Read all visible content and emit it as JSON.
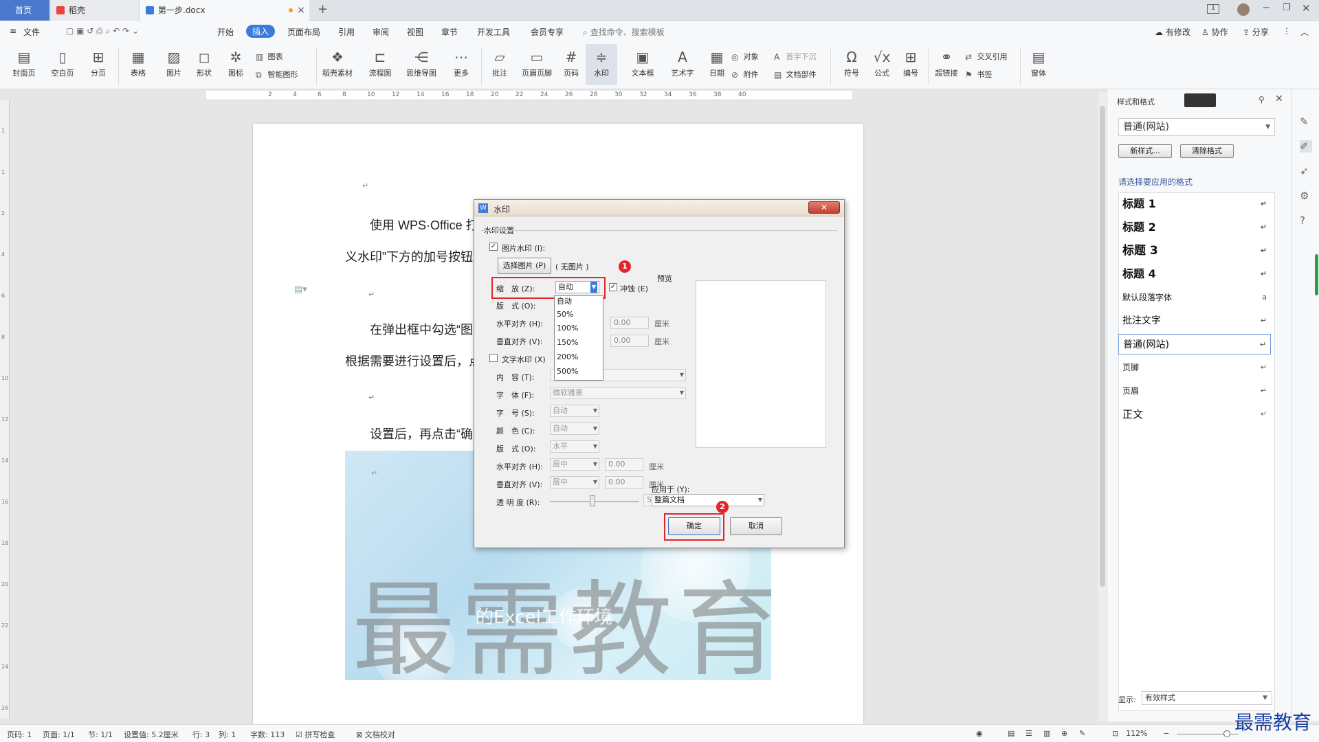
{
  "tabs": {
    "home": "首页",
    "daoke": "稻壳",
    "doc": "第一步.docx"
  },
  "menu": {
    "file": "文件",
    "start": "开始",
    "insert": "插入",
    "layout": "页面布局",
    "ref": "引用",
    "review": "审阅",
    "view": "视图",
    "chapter": "章节",
    "dev": "开发工具",
    "member": "会员专享",
    "search": "查找命令、搜索模板",
    "modified": "有修改",
    "collab": "协作",
    "share": "分享"
  },
  "ribbon": {
    "cover": "封面页",
    "blank": "空白页",
    "pagebreak": "分页",
    "table": "表格",
    "picture": "图片",
    "shape": "形状",
    "icon": "图标",
    "chart": "图表",
    "smart": "智能图形",
    "material": "稻壳素材",
    "flow": "流程图",
    "mind": "思维导图",
    "more": "更多",
    "comment": "批注",
    "headerfooter": "页眉页脚",
    "pagenum": "页码",
    "watermark": "水印",
    "textbox": "文本框",
    "wordart": "艺术字",
    "date": "日期",
    "object": "对象",
    "attach": "附件",
    "dropcap": "首字下沉",
    "docpart": "文档部件",
    "symbol": "符号",
    "formula": "公式",
    "number": "编号",
    "hyperlink": "超链接",
    "crossref": "交叉引用",
    "bookmark": "书签",
    "window": "窗体"
  },
  "doc": {
    "p1": "使用 WPS·Office 打",
    "p2": "义水印”下方的加号按钮",
    "p3": "在弹出框中勾选“图",
    "p4": "根据需要进行设置后，点",
    "p5": "设置后，再点击“确",
    "wm_main": "最需教育",
    "wm_sub": "的Excel工作环境"
  },
  "dialog": {
    "title": "水印",
    "close": "✕",
    "section": "水印设置",
    "pic_wm": "图片水印 (I):",
    "select_pic": "选择图片 (P)",
    "no_pic": "( 无图片 )",
    "scale": "缩　放 (Z):",
    "scale_val": "自动",
    "washout": "冲蚀 (E)",
    "layout": "版　式 (O):",
    "halign": "水平对齐 (H):",
    "valign": "垂直对齐 (V):",
    "h_val": "0.00",
    "v_val": "0.00",
    "cm": "厘米",
    "text_wm": "文字水印 (X)",
    "content": "内　容 (T):",
    "font": "字　体 (F):",
    "font_val": "微软雅黑",
    "size": "字　号 (S):",
    "size_val": "自动",
    "color": "颜　色 (C):",
    "color_val": "自动",
    "tlayout": "版　式 (O):",
    "tlayout_val": "水平",
    "thalign": "水平对齐 (H):",
    "thalign_val": "居中",
    "tvalign": "垂直对齐 (V):",
    "tvalign_val": "居中",
    "t_h": "0.00",
    "t_v": "0.00",
    "opacity": "透 明 度 (R):",
    "opacity_val": "50",
    "pct": "%",
    "preview": "预览",
    "apply": "应用于 (Y):",
    "apply_val": "整篇文档",
    "ok": "确定",
    "cancel": "取消",
    "options": [
      "自动",
      "50%",
      "100%",
      "150%",
      "200%",
      "500%"
    ],
    "badge1": "1",
    "badge2": "2"
  },
  "rightpane": {
    "title": "样式和格式",
    "current": "普通(网站)",
    "new": "新样式...",
    "clear": "清除格式",
    "prompt": "请选择要应用的格式",
    "styles": [
      "标题 1",
      "标题 2",
      "标题 3",
      "标题 4",
      "默认段落字体",
      "批注文字",
      "普通(网站)",
      "页脚",
      "页眉",
      "正文"
    ],
    "show": "显示:",
    "show_val": "有效样式"
  },
  "status": {
    "page": "页码: 1",
    "pages": "页面: 1/1",
    "section": "节: 1/1",
    "setting": "设置值: 5.2厘米",
    "row": "行: 3",
    "col": "列: 1",
    "words": "字数: 113",
    "spell": "拼写检查",
    "proof": "文档校对",
    "zoom": "112%"
  },
  "brand": "最需教育"
}
